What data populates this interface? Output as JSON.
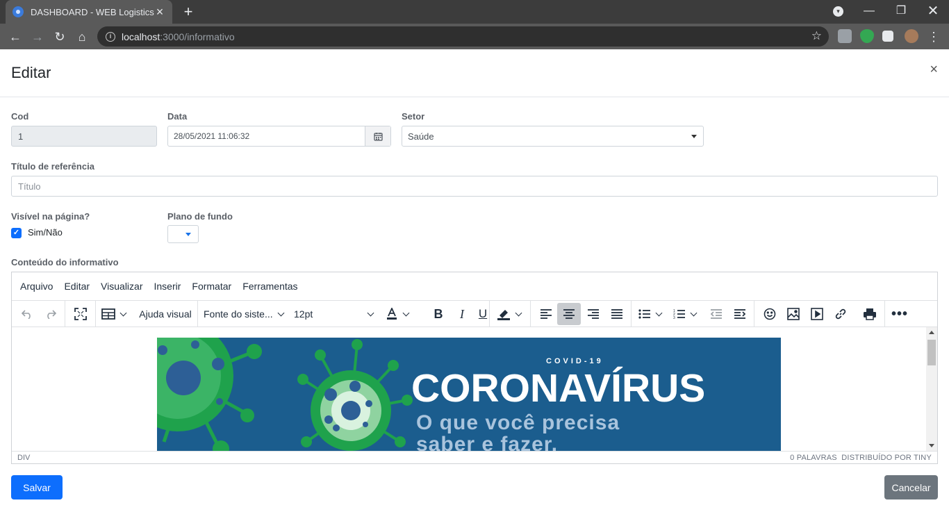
{
  "browser": {
    "tab_title": "DASHBOARD - WEB Logistics",
    "url_host": "localhost",
    "url_path": ":3000/informativo"
  },
  "modal": {
    "title": "Editar",
    "close_symbol": "×"
  },
  "form": {
    "cod_label": "Cod",
    "cod_value": "1",
    "data_label": "Data",
    "data_value": "28/05/2021 11:06:32",
    "setor_label": "Setor",
    "setor_value": "Saúde",
    "titulo_label": "Título de referência",
    "titulo_placeholder": "Título",
    "visivel_label": "Visível na página?",
    "visivel_checkbox_label": "Sim/Não",
    "visivel_checked": true,
    "plano_label": "Plano de fundo",
    "conteudo_label": "Conteúdo do informativo"
  },
  "editor": {
    "menu": [
      "Arquivo",
      "Editar",
      "Visualizar",
      "Inserir",
      "Formatar",
      "Ferramentas"
    ],
    "visual_aid": "Ajuda visual",
    "font_family": "Fonte do siste...",
    "font_size": "12pt",
    "status_left": "DIV",
    "status_right": "0 PALAVRAS  DISTRIBUÍDO POR TINY",
    "banner": {
      "tag": "COVID-19",
      "headline": "CORONAVÍRUS",
      "sub1": "O que você precisa",
      "sub2": "saber e fazer.",
      "bg_color": "#1b5d8e",
      "virus_color": "#1fa24c"
    }
  },
  "actions": {
    "save": "Salvar",
    "cancel": "Cancelar"
  },
  "colors": {
    "primary": "#0d6efd",
    "secondary": "#6c757d"
  }
}
